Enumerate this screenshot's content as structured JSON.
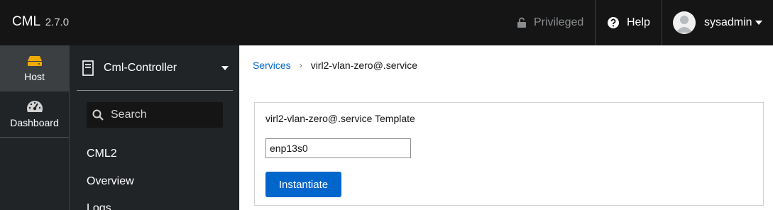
{
  "header": {
    "brand": "CML",
    "version": "2.7.0",
    "privileged_label": "Privileged",
    "help_label": "Help",
    "user_label": "sysadmin"
  },
  "icon_nav": {
    "items": [
      {
        "label": "Host",
        "icon": "server-icon",
        "active": true
      },
      {
        "label": "Dashboard",
        "icon": "tachometer-icon",
        "active": false
      }
    ]
  },
  "sidebar": {
    "host_selector": "Cml-Controller",
    "search_placeholder": "Search",
    "items": [
      {
        "label": "CML2"
      },
      {
        "label": "Overview"
      },
      {
        "label": "Logs"
      }
    ]
  },
  "breadcrumb": {
    "parent": "Services",
    "current": "virl2-vlan-zero@.service"
  },
  "template_panel": {
    "title": "virl2-vlan-zero@.service Template",
    "input_value": "enp13s0",
    "button_label": "Instantiate"
  },
  "colors": {
    "topbar": "#151515",
    "nav_bg": "#212427",
    "accent": "#0066cc",
    "host_icon": "#f0ab00"
  }
}
